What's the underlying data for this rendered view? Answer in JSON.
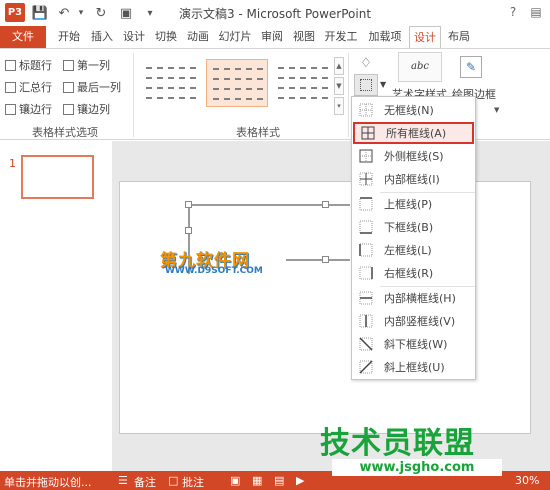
{
  "app": {
    "icon_label": "P3",
    "title": "演示文稿3 - Microsoft PowerPoint"
  },
  "quick_access": [
    "save-icon",
    "undo-icon",
    "redo-icon",
    "screen-icon",
    "customize-icon"
  ],
  "window_controls": [
    "help-icon",
    "ribbon-display-icon"
  ],
  "tabs": [
    "文件",
    "开始",
    "插入",
    "设计",
    "切换",
    "动画",
    "幻灯片",
    "审阅",
    "视图",
    "开发工",
    "加载项",
    "设计",
    "布局"
  ],
  "style_options": {
    "items": [
      "标题行",
      "第一列",
      "汇总行",
      "最后一列",
      "镶边行",
      "镶边列"
    ],
    "group_label": "表格样式选项"
  },
  "table_styles": {
    "group_label": "表格样式"
  },
  "wordart": {
    "label": "艺术字样式",
    "icon_text": "abc"
  },
  "draw_borders": {
    "label": "绘图边框"
  },
  "borders_menu": {
    "items": [
      "无框线(N)",
      "所有框线(A)",
      "外侧框线(S)",
      "内部框线(I)",
      "上框线(P)",
      "下框线(B)",
      "左框线(L)",
      "右框线(R)",
      "内部横框线(H)",
      "内部竖框线(V)",
      "斜下框线(W)",
      "斜上框线(U)"
    ],
    "highlighted_index": 1
  },
  "slides": {
    "number": "1"
  },
  "watermark": {
    "cn": "第九软件网",
    "url": "WWW.D9SOFT.COM"
  },
  "status": {
    "left": "单击并拖动以创...",
    "notes": "备注",
    "comments": "批注",
    "zoom": "30%"
  },
  "site": {
    "logo": "技术员联盟",
    "url": "www.jsgho.com"
  },
  "colors": {
    "accent": "#d24726",
    "highlight_border": "#d8342a",
    "site_green": "#1aa33a"
  }
}
